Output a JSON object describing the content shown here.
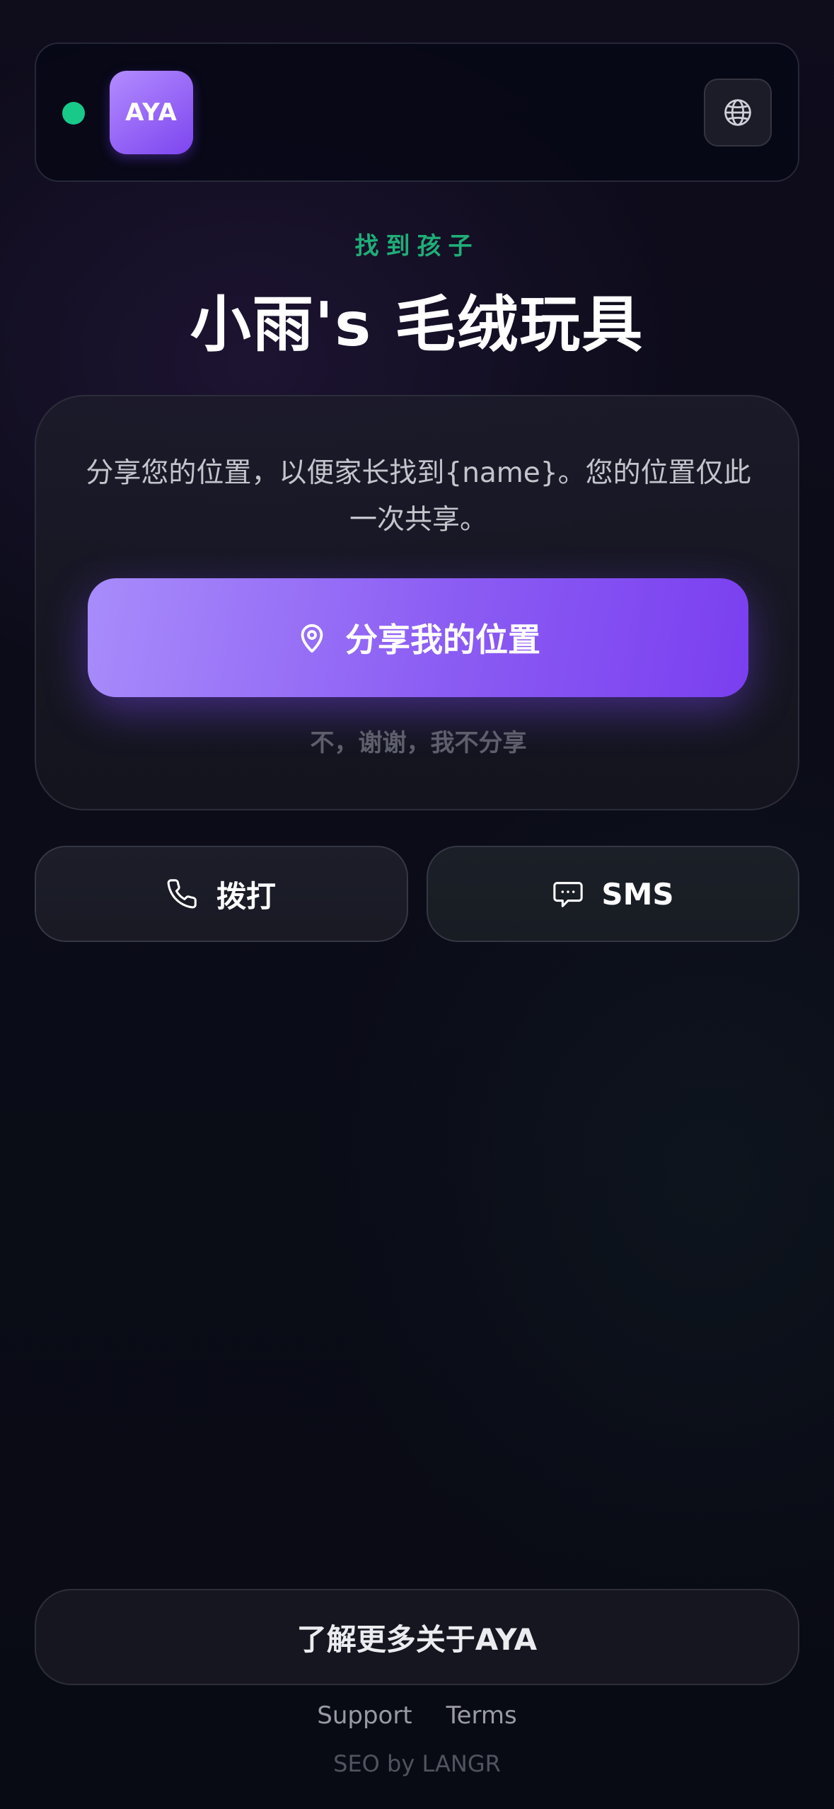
{
  "header": {
    "logo_text": "AYA",
    "status_color": "#18c98a",
    "language_icon": "globe-icon"
  },
  "hero": {
    "eyebrow": "找到孩子",
    "title": "小雨's 毛绒玩具"
  },
  "share_card": {
    "description": "分享您的位置，以便家长找到{name}。您的位置仅此一次共享。",
    "share_button_label": "分享我的位置",
    "share_button_icon": "location-pin-icon",
    "decline_label": "不，谢谢，我不分享"
  },
  "contact": {
    "call_label": "拨打",
    "call_icon": "phone-icon",
    "sms_label": "SMS",
    "sms_icon": "chat-bubble-icon"
  },
  "footer": {
    "learn_more_label": "了解更多关于AYA",
    "support_label": "Support",
    "terms_label": "Terms",
    "seo_text": "SEO by LANGR"
  },
  "colors": {
    "accent_purple": "#8b5cf3",
    "accent_green": "#1fae78",
    "background": "#0a0b14"
  }
}
